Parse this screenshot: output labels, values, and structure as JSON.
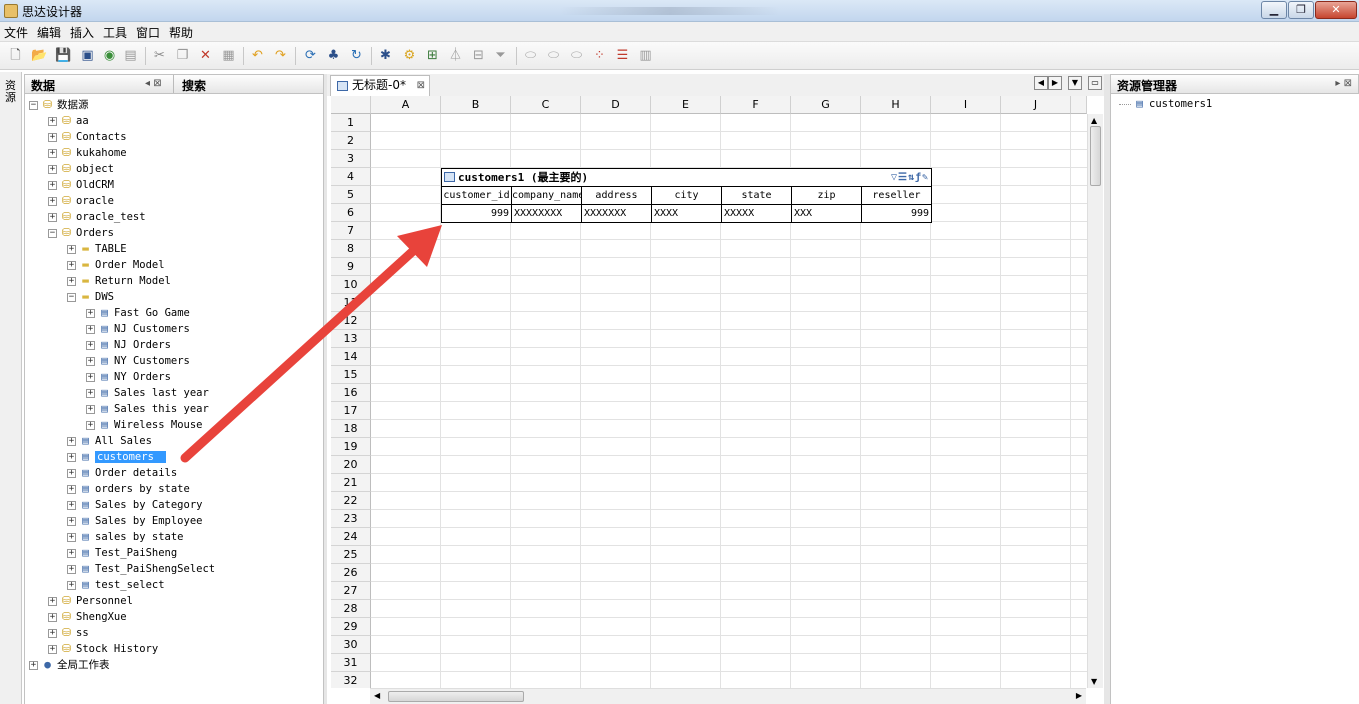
{
  "window": {
    "title": "思达设计器",
    "minimize": "▁",
    "restore": "❐",
    "close": "✕"
  },
  "menu": [
    "文件",
    "编辑",
    "插入",
    "工具",
    "窗口",
    "帮助"
  ],
  "left_strip": {
    "label": "资源"
  },
  "left_panel": {
    "tab_data": "数据",
    "tab_search": "搜索",
    "pin": "◂ ⊠"
  },
  "tree": [
    {
      "label": "数据源",
      "icon": "database-icon",
      "level": 0,
      "expanded": true
    },
    {
      "label": "aa",
      "icon": "database-icon",
      "level": 1
    },
    {
      "label": "Contacts",
      "icon": "database-icon",
      "level": 1
    },
    {
      "label": "kukahome",
      "icon": "database-icon",
      "level": 1
    },
    {
      "label": "object",
      "icon": "database-icon",
      "level": 1
    },
    {
      "label": "OldCRM",
      "icon": "database-icon",
      "level": 1
    },
    {
      "label": "oracle",
      "icon": "database-icon",
      "level": 1
    },
    {
      "label": "oracle_test",
      "icon": "database-icon",
      "level": 1
    },
    {
      "label": "Orders",
      "icon": "database-icon",
      "level": 1,
      "expanded": true
    },
    {
      "label": "TABLE",
      "icon": "folder-icon",
      "level": 2
    },
    {
      "label": "Order Model",
      "icon": "folder-icon",
      "level": 2
    },
    {
      "label": "Return Model",
      "icon": "folder-icon",
      "level": 2
    },
    {
      "label": "DWS",
      "icon": "folder-icon",
      "level": 2,
      "expanded": true
    },
    {
      "label": "Fast Go Game",
      "icon": "table-icon",
      "level": 3
    },
    {
      "label": "NJ Customers",
      "icon": "table-icon",
      "level": 3
    },
    {
      "label": "NJ Orders",
      "icon": "table-icon",
      "level": 3
    },
    {
      "label": "NY Customers",
      "icon": "table-icon",
      "level": 3
    },
    {
      "label": "NY Orders",
      "icon": "table-icon",
      "level": 3
    },
    {
      "label": "Sales last year",
      "icon": "table-icon",
      "level": 3
    },
    {
      "label": "Sales this year",
      "icon": "table-icon",
      "level": 3
    },
    {
      "label": "Wireless Mouse",
      "icon": "table-icon",
      "level": 3
    },
    {
      "label": "All Sales",
      "icon": "table-icon",
      "level": 2
    },
    {
      "label": "customers",
      "icon": "table-icon",
      "level": 2,
      "selected": true
    },
    {
      "label": "Order details",
      "icon": "table-icon",
      "level": 2
    },
    {
      "label": "orders by state",
      "icon": "table-icon",
      "level": 2
    },
    {
      "label": "Sales by Category",
      "icon": "table-icon",
      "level": 2
    },
    {
      "label": "Sales by Employee",
      "icon": "table-icon",
      "level": 2
    },
    {
      "label": "sales by state",
      "icon": "table-icon",
      "level": 2
    },
    {
      "label": "Test_PaiSheng",
      "icon": "table-icon",
      "level": 2
    },
    {
      "label": "Test_PaiShengSelect",
      "icon": "table-icon",
      "level": 2
    },
    {
      "label": "test_select",
      "icon": "table-icon",
      "level": 2
    },
    {
      "label": "Personnel",
      "icon": "database-icon",
      "level": 1
    },
    {
      "label": "ShengXue",
      "icon": "database-icon",
      "level": 1
    },
    {
      "label": "ss",
      "icon": "database-icon",
      "level": 1
    },
    {
      "label": "Stock History",
      "icon": "database-icon",
      "level": 1
    },
    {
      "label": "全局工作表",
      "icon": "globe-icon",
      "level": 0
    }
  ],
  "document_tab": {
    "label": "无标题-0*",
    "close": "⊠"
  },
  "sheet": {
    "columns": [
      "A",
      "B",
      "C",
      "D",
      "E",
      "F",
      "G",
      "H",
      "I",
      "J"
    ],
    "rows": [
      "1",
      "2",
      "3",
      "4",
      "5",
      "6",
      "7",
      "8",
      "9",
      "10",
      "11",
      "12",
      "13",
      "14",
      "15",
      "16",
      "17",
      "18",
      "19",
      "20",
      "21",
      "22",
      "23",
      "24",
      "25",
      "26",
      "27",
      "28",
      "29",
      "30",
      "31",
      "32"
    ]
  },
  "data_table": {
    "title": "customers1 (最主要的)",
    "tools": "▽☰⇅ƒ✎",
    "headers": [
      "customer_id",
      "company_name",
      "address",
      "city",
      "state",
      "zip",
      "reseller"
    ],
    "row": [
      "999",
      "XXXXXXXX",
      "XXXXXXX",
      "XXXX",
      "XXXXX",
      "XXX",
      "999"
    ]
  },
  "right_panel": {
    "title": "资源管理器",
    "pin": "▸ ⊠",
    "items": [
      "customers1"
    ]
  }
}
